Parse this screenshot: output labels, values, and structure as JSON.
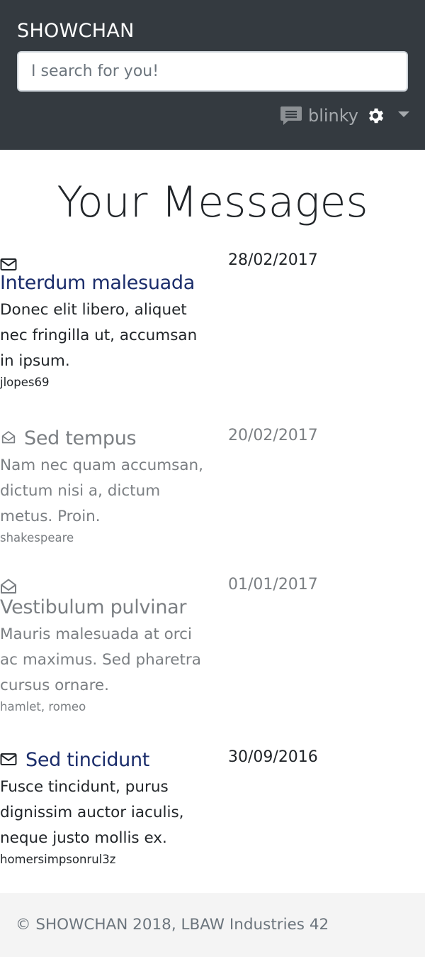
{
  "nav": {
    "brand": "SHOWCHAN",
    "search_placeholder": "I search for you!",
    "username": "blinky",
    "icons": [
      "chat-icon",
      "gear-icon",
      "caret-down-icon"
    ]
  },
  "page": {
    "title": "Your Messages"
  },
  "messages": [
    {
      "subject": "Interdum malesuada",
      "preview": "Donec elit libero, aliquet nec fringilla ut, accumsan in ipsum.",
      "sender": "jlopes69",
      "date": "28/02/2017",
      "status": "unread",
      "icon": "envelope-closed-icon"
    },
    {
      "subject": "Sed tempus",
      "preview": "Nam nec quam accumsan, dictum nisi a, dictum metus. Proin.",
      "sender": "shakespeare",
      "date": "20/02/2017",
      "status": "read",
      "icon": "envelope-open-icon"
    },
    {
      "subject": "Vestibulum pulvinar",
      "preview": "Mauris malesuada at orci ac maximus. Sed pharetra cursus ornare.",
      "sender": "hamlet, romeo",
      "date": "01/01/2017",
      "status": "read",
      "icon": "envelope-open-icon"
    },
    {
      "subject": "Sed tincidunt",
      "preview": "Fusce tincidunt, purus dignissim auctor iaculis, neque justo mollis ex.",
      "sender": "homersimpsonrul3z",
      "date": "30/09/2016",
      "status": "unread",
      "icon": "envelope-closed-icon"
    }
  ],
  "footer": {
    "text": "© SHOWCHAN 2018, LBAW Industries 42"
  },
  "colors": {
    "navbar": "#343a40",
    "unread_subject": "#1b2d6b",
    "read_text": "#7b7f83",
    "footer_bg": "#f4f4f4"
  }
}
